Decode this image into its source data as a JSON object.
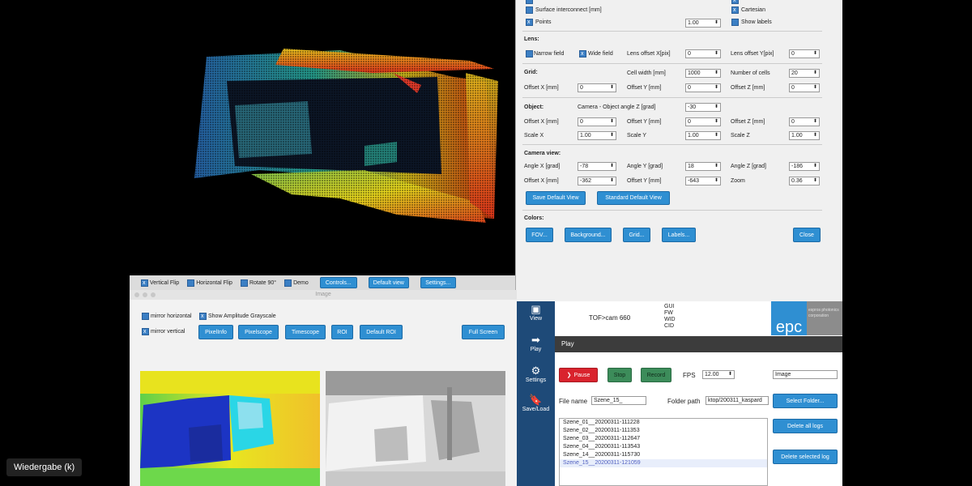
{
  "viewer": {
    "toolbar": {
      "vertical_flip": "Vertical Flip",
      "horizontal_flip": "Horizontal Flip",
      "rotate": "Rotate 90°",
      "demo": "Demo",
      "controls_btn": "Controls...",
      "default_view_btn": "Default view",
      "settings_btn": "Settings..."
    }
  },
  "controls": {
    "top": {
      "surface_label": "Surface interconnect [mm]",
      "points_label": "Points",
      "points_value": "1.00",
      "cartesian_label": "Cartesian",
      "show_labels_label": "Show labels"
    },
    "lens": {
      "title": "Lens:",
      "narrow": "Narrow field",
      "wide": "Wide field",
      "offset_x_label": "Lens offset X[pix]",
      "offset_x": "0",
      "offset_y_label": "Lens offset Y[pix]",
      "offset_y": "0"
    },
    "grid": {
      "title": "Grid:",
      "cell_width_label": "Cell width [mm]",
      "cell_width": "1000",
      "num_cells_label": "Number of cells",
      "num_cells": "20",
      "offset_x_label": "Offset X [mm]",
      "offset_x": "0",
      "offset_y_label": "Offset Y [mm]",
      "offset_y": "0",
      "offset_z_label": "Offset Z [mm]",
      "offset_z": "0"
    },
    "object": {
      "title": "Object:",
      "angle_label": "Camera - Object angle Z [grad]",
      "angle": "-30",
      "offset_x_label": "Offset X [mm]",
      "offset_x": "0",
      "offset_y_label": "Offset Y [mm]",
      "offset_y": "0",
      "offset_z_label": "Offset Z [mm]",
      "offset_z": "0",
      "scale_x_label": "Scale X",
      "scale_x": "1.00",
      "scale_y_label": "Scale Y",
      "scale_y": "1.00",
      "scale_z_label": "Scale Z",
      "scale_z": "1.00"
    },
    "camera": {
      "title": "Camera view:",
      "angle_x_label": "Angle  X [grad]",
      "angle_x": "-78",
      "angle_y_label": "Angle Y [grad]",
      "angle_y": "18",
      "angle_z_label": "Angle Z [grad]",
      "angle_z": "-186",
      "offset_x_label": "Offset X [mm]",
      "offset_x": "-362",
      "offset_y_label": "Offset Y [mm]",
      "offset_y": "-643",
      "zoom_label": "Zoom",
      "zoom": "0.36",
      "save_default": "Save Default View",
      "standard_default": "Standard Default View"
    },
    "colors": {
      "title": "Colors:",
      "fov": "FOV...",
      "background": "Background...",
      "grid": "Grid...",
      "labels": "Labels...",
      "close": "Close"
    }
  },
  "image_window": {
    "title": "Image",
    "mirror_horizontal": "mirror horizontal",
    "mirror_vertical": "mirror vertical",
    "show_amplitude": "Show Amplitude Grayscale",
    "buttons": [
      "PixelInfo",
      "Pixelscope",
      "Timescope",
      "ROI",
      "Default ROI"
    ],
    "full_screen": "Full Screen"
  },
  "tof": {
    "sidebar": [
      {
        "label": "View",
        "icon": "image-icon"
      },
      {
        "label": "Play",
        "icon": "play-arrow-icon"
      },
      {
        "label": "Settings",
        "icon": "gear-icon"
      },
      {
        "label": "Save/Load",
        "icon": "bookmark-icon"
      }
    ],
    "header": {
      "device": "TOF>cam 660",
      "info": [
        "GUI",
        "FW",
        "WID",
        "CID"
      ],
      "logo": "epc",
      "company": "espros photonics corporation"
    },
    "section_title": "Play",
    "pause": "Pause",
    "stop": "Stop",
    "record": "Record",
    "fps_label": "FPS",
    "fps_value": "12.00",
    "mode_value": "Image",
    "file_name_label": "File name",
    "file_name_value": "Szene_15_",
    "folder_path_label": "Folder path",
    "folder_path_value": "ktop/200311_kaspard",
    "select_folder": "Select Folder...",
    "delete_all": "Delete all logs",
    "delete_selected": "Delete selected log",
    "logs": [
      "Szene_01__20200311-111228",
      "Szene_02__20200311-111353",
      "Szene_03__20200311-112647",
      "Szene_04__20200311-113543",
      "Szene_14__20200311-115730",
      "Szene_15__20200311-121059"
    ]
  },
  "overlay": {
    "wiedergabe": "Wiedergabe (k)"
  },
  "colors": {
    "accent": "#2f8fd2",
    "sidebar": "#1e4a78",
    "pause": "#d9232d",
    "stop": "#3c8c5a"
  }
}
